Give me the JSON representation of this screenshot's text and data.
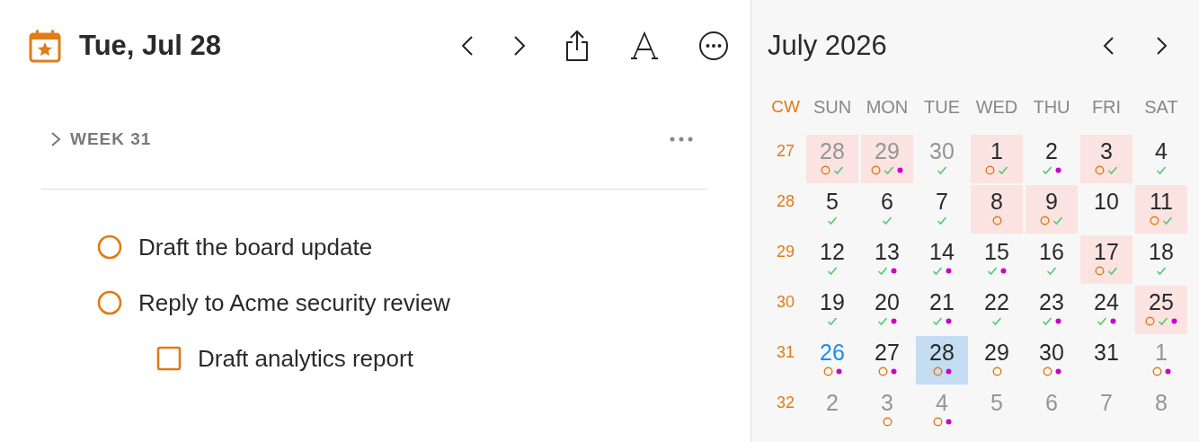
{
  "header": {
    "title": "Tue, Jul 28"
  },
  "week_section": {
    "label": "WEEK 31",
    "expanded": false
  },
  "tasks": [
    {
      "title": "Draft the board update",
      "kind": "task",
      "checked": false
    },
    {
      "title": "Reply to Acme security review",
      "kind": "task",
      "checked": false,
      "children": [
        {
          "title": "Draft analytics report",
          "kind": "subtask",
          "checked": false
        }
      ]
    }
  ],
  "calendar": {
    "title": "July 2026",
    "cw_label": "CW",
    "weekdays": [
      "SUN",
      "MON",
      "TUE",
      "WED",
      "THU",
      "FRI",
      "SAT"
    ],
    "weeks": [
      {
        "cw": "27",
        "days": [
          {
            "day": "28",
            "other_month": true,
            "highlight": true,
            "selected": false,
            "today": false,
            "markers": [
              {
                "kind": "open"
              },
              {
                "kind": "done"
              }
            ]
          },
          {
            "day": "29",
            "other_month": true,
            "highlight": true,
            "selected": false,
            "today": false,
            "markers": [
              {
                "kind": "open"
              },
              {
                "kind": "done"
              },
              {
                "kind": "event"
              }
            ]
          },
          {
            "day": "30",
            "other_month": true,
            "highlight": false,
            "selected": false,
            "today": false,
            "markers": [
              {
                "kind": "done"
              }
            ]
          },
          {
            "day": "1",
            "other_month": false,
            "highlight": true,
            "selected": false,
            "today": false,
            "markers": [
              {
                "kind": "open"
              },
              {
                "kind": "done"
              }
            ]
          },
          {
            "day": "2",
            "other_month": false,
            "highlight": false,
            "selected": false,
            "today": false,
            "markers": [
              {
                "kind": "done"
              },
              {
                "kind": "event"
              }
            ]
          },
          {
            "day": "3",
            "other_month": false,
            "highlight": true,
            "selected": false,
            "today": false,
            "markers": [
              {
                "kind": "open"
              },
              {
                "kind": "done"
              }
            ]
          },
          {
            "day": "4",
            "other_month": false,
            "highlight": false,
            "selected": false,
            "today": false,
            "markers": [
              {
                "kind": "done"
              }
            ]
          }
        ]
      },
      {
        "cw": "28",
        "days": [
          {
            "day": "5",
            "other_month": false,
            "highlight": false,
            "selected": false,
            "today": false,
            "markers": [
              {
                "kind": "done"
              }
            ]
          },
          {
            "day": "6",
            "other_month": false,
            "highlight": false,
            "selected": false,
            "today": false,
            "markers": [
              {
                "kind": "done"
              }
            ]
          },
          {
            "day": "7",
            "other_month": false,
            "highlight": false,
            "selected": false,
            "today": false,
            "markers": [
              {
                "kind": "done"
              }
            ]
          },
          {
            "day": "8",
            "other_month": false,
            "highlight": true,
            "selected": false,
            "today": false,
            "markers": [
              {
                "kind": "open"
              }
            ]
          },
          {
            "day": "9",
            "other_month": false,
            "highlight": true,
            "selected": false,
            "today": false,
            "markers": [
              {
                "kind": "open"
              },
              {
                "kind": "done"
              }
            ]
          },
          {
            "day": "10",
            "other_month": false,
            "highlight": false,
            "selected": false,
            "today": false
          },
          {
            "day": "11",
            "other_month": false,
            "highlight": true,
            "selected": false,
            "today": false,
            "markers": [
              {
                "kind": "open"
              },
              {
                "kind": "done"
              }
            ]
          }
        ]
      },
      {
        "cw": "29",
        "days": [
          {
            "day": "12",
            "other_month": false,
            "highlight": false,
            "selected": false,
            "today": false,
            "markers": [
              {
                "kind": "done"
              }
            ]
          },
          {
            "day": "13",
            "other_month": false,
            "highlight": false,
            "selected": false,
            "today": false,
            "markers": [
              {
                "kind": "done"
              },
              {
                "kind": "event"
              }
            ]
          },
          {
            "day": "14",
            "other_month": false,
            "highlight": false,
            "selected": false,
            "today": false,
            "markers": [
              {
                "kind": "done"
              },
              {
                "kind": "event"
              }
            ]
          },
          {
            "day": "15",
            "other_month": false,
            "highlight": false,
            "selected": false,
            "today": false,
            "markers": [
              {
                "kind": "done"
              },
              {
                "kind": "event"
              }
            ]
          },
          {
            "day": "16",
            "other_month": false,
            "highlight": false,
            "selected": false,
            "today": false,
            "markers": [
              {
                "kind": "done"
              }
            ]
          },
          {
            "day": "17",
            "other_month": false,
            "highlight": true,
            "selected": false,
            "today": false,
            "markers": [
              {
                "kind": "open"
              },
              {
                "kind": "done"
              }
            ]
          },
          {
            "day": "18",
            "other_month": false,
            "highlight": false,
            "selected": false,
            "today": false,
            "markers": [
              {
                "kind": "done"
              }
            ]
          }
        ]
      },
      {
        "cw": "30",
        "days": [
          {
            "day": "19",
            "other_month": false,
            "highlight": false,
            "selected": false,
            "today": false,
            "markers": [
              {
                "kind": "done"
              }
            ]
          },
          {
            "day": "20",
            "other_month": false,
            "highlight": false,
            "selected": false,
            "today": false,
            "markers": [
              {
                "kind": "done"
              },
              {
                "kind": "event"
              }
            ]
          },
          {
            "day": "21",
            "other_month": false,
            "highlight": false,
            "selected": false,
            "today": false,
            "markers": [
              {
                "kind": "done"
              },
              {
                "kind": "event"
              }
            ]
          },
          {
            "day": "22",
            "other_month": false,
            "highlight": false,
            "selected": false,
            "today": false,
            "markers": [
              {
                "kind": "done"
              }
            ]
          },
          {
            "day": "23",
            "other_month": false,
            "highlight": false,
            "selected": false,
            "today": false,
            "markers": [
              {
                "kind": "done"
              },
              {
                "kind": "event"
              }
            ]
          },
          {
            "day": "24",
            "other_month": false,
            "highlight": false,
            "selected": false,
            "today": false,
            "markers": [
              {
                "kind": "done"
              },
              {
                "kind": "event"
              }
            ]
          },
          {
            "day": "25",
            "other_month": false,
            "highlight": true,
            "selected": false,
            "today": false,
            "markers": [
              {
                "kind": "open"
              },
              {
                "kind": "done"
              },
              {
                "kind": "event"
              }
            ]
          }
        ]
      },
      {
        "cw": "31",
        "days": [
          {
            "day": "26",
            "other_month": false,
            "highlight": false,
            "selected": false,
            "today": true,
            "markers": [
              {
                "kind": "open"
              },
              {
                "kind": "event"
              }
            ]
          },
          {
            "day": "27",
            "other_month": false,
            "highlight": false,
            "selected": false,
            "today": false,
            "markers": [
              {
                "kind": "open"
              },
              {
                "kind": "event"
              }
            ]
          },
          {
            "day": "28",
            "other_month": false,
            "highlight": false,
            "selected": true,
            "today": false,
            "markers": [
              {
                "kind": "open"
              },
              {
                "kind": "event"
              }
            ]
          },
          {
            "day": "29",
            "other_month": false,
            "highlight": false,
            "selected": false,
            "today": false,
            "markers": [
              {
                "kind": "open"
              }
            ]
          },
          {
            "day": "30",
            "other_month": false,
            "highlight": false,
            "selected": false,
            "today": false,
            "markers": [
              {
                "kind": "open"
              },
              {
                "kind": "event"
              }
            ]
          },
          {
            "day": "31",
            "other_month": false,
            "highlight": false,
            "selected": false,
            "today": false
          },
          {
            "day": "1",
            "other_month": true,
            "highlight": false,
            "selected": false,
            "today": false,
            "markers": [
              {
                "kind": "open"
              },
              {
                "kind": "event"
              }
            ]
          }
        ]
      },
      {
        "cw": "32",
        "days": [
          {
            "day": "2",
            "other_month": true,
            "highlight": false,
            "selected": false,
            "today": false
          },
          {
            "day": "3",
            "other_month": true,
            "highlight": false,
            "selected": false,
            "today": false,
            "markers": [
              {
                "kind": "open"
              }
            ]
          },
          {
            "day": "4",
            "other_month": true,
            "highlight": false,
            "selected": false,
            "today": false,
            "markers": [
              {
                "kind": "open"
              },
              {
                "kind": "event"
              }
            ]
          },
          {
            "day": "5",
            "other_month": true,
            "highlight": false,
            "selected": false,
            "today": false
          },
          {
            "day": "6",
            "other_month": true,
            "highlight": false,
            "selected": false,
            "today": false
          },
          {
            "day": "7",
            "other_month": true,
            "highlight": false,
            "selected": false,
            "today": false
          },
          {
            "day": "8",
            "other_month": true,
            "highlight": false,
            "selected": false,
            "today": false
          }
        ]
      }
    ]
  }
}
